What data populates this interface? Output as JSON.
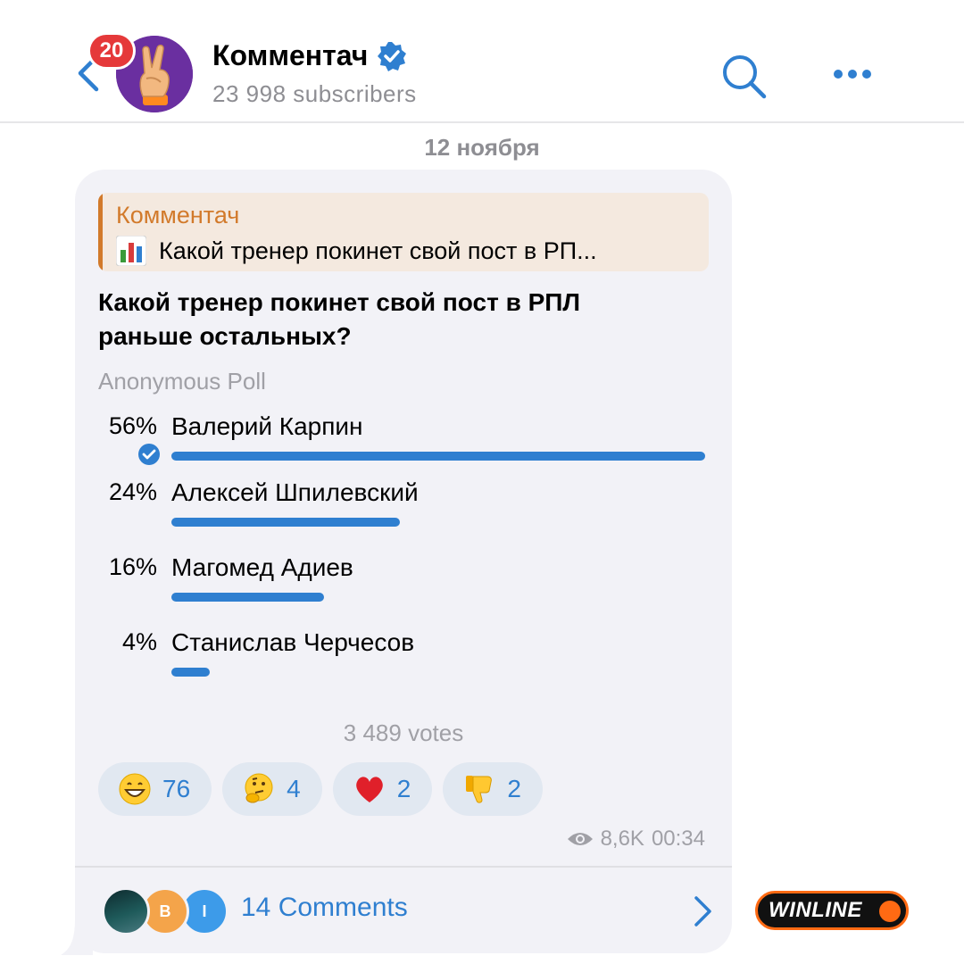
{
  "header": {
    "unread_count": "20",
    "channel_title": "Комментач",
    "subscribers": "23 998 subscribers"
  },
  "date_label": "12 ноября",
  "reply": {
    "author": "Комментач",
    "text": "Какой тренер покинет свой пост в РП..."
  },
  "poll": {
    "question": "Какой тренер покинет свой пост в РПЛ раньше остальных?",
    "type": "Anonymous Poll",
    "options": [
      {
        "percent": "56%",
        "label": "Валерий Карпин",
        "fraction": 0.56,
        "chosen": true
      },
      {
        "percent": "24%",
        "label": "Алексей Шпилевский",
        "fraction": 0.24,
        "chosen": false
      },
      {
        "percent": "16%",
        "label": "Магомед Адиев",
        "fraction": 0.16,
        "chosen": false
      },
      {
        "percent": "4%",
        "label": "Станислав Черчесов",
        "fraction": 0.04,
        "chosen": false
      }
    ],
    "votes": "3 489 votes"
  },
  "reactions": [
    {
      "emoji": "grinning-face-icon",
      "count": "76"
    },
    {
      "emoji": "thinking-face-icon",
      "count": "4"
    },
    {
      "emoji": "red-heart-icon",
      "count": "2"
    },
    {
      "emoji": "thumbs-down-icon",
      "count": "2"
    }
  ],
  "meta": {
    "views": "8,6K",
    "time": "00:34"
  },
  "comments": {
    "label": "14 Comments",
    "avatar_letters": [
      "",
      "В",
      "I"
    ]
  },
  "brand": {
    "watermark": "WINLINE"
  },
  "colors": {
    "accent": "#2f7fd0",
    "reply_accent": "#d27a2b",
    "badge": "#e5393a",
    "bubble": "#f2f2f7",
    "winline_orange": "#ff6a13"
  }
}
